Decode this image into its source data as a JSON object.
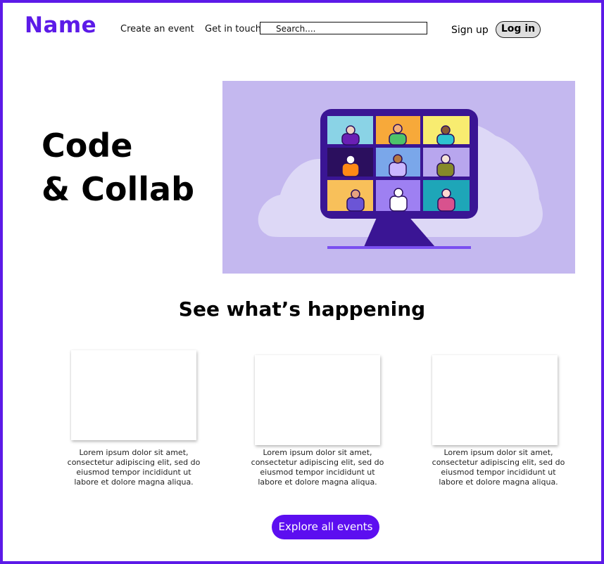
{
  "brand": {
    "logo": "Name",
    "accent": "#5c1ae8",
    "button_color": "#5c0ef0"
  },
  "nav": {
    "create_event": "Create an event",
    "get_in_touch": "Get in touch",
    "search_placeholder": "Search....",
    "sign_up": "Sign up",
    "log_in": "Log in"
  },
  "hero": {
    "title_line1": "Code",
    "title_line2": "& Collab",
    "illustration": "video-call-monitor-illustration",
    "colors": {
      "background": "#c4b8ef",
      "blob": "#ddd8f6",
      "monitor": "#3a1594",
      "stand_line": "#7a4ff0"
    }
  },
  "events": {
    "title": "See what’s happening",
    "cards": [
      {
        "text": "Lorem ipsum dolor sit amet, consectetur adipiscing elit, sed do eiusmod tempor incididunt ut labore et dolore magna aliqua."
      },
      {
        "text": "Lorem ipsum dolor sit amet, consectetur adipiscing elit, sed do eiusmod tempor incididunt ut labore et dolore magna aliqua."
      },
      {
        "text": "Lorem ipsum dolor sit amet, consectetur adipiscing elit, sed do eiusmod tempor incididunt ut labore et dolore magna aliqua."
      }
    ],
    "explore_button": "Explore all events"
  }
}
